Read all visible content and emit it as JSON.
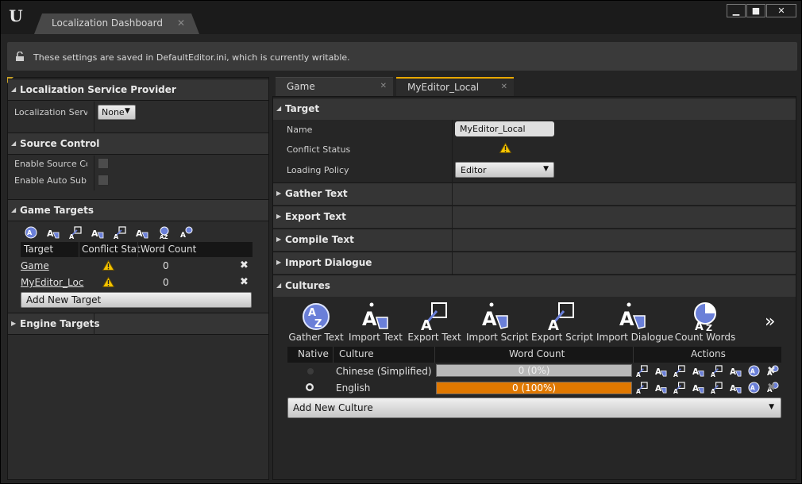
{
  "window": {
    "tab_title": "Localization Dashboard",
    "tab_close": "✕",
    "controls": {
      "minimize": "▁",
      "maximize": "■",
      "close": "✕"
    }
  },
  "infobar": {
    "text": "These settings are saved in DefaultEditor.ini, which is currently writable."
  },
  "left_panel": {
    "provider": {
      "header": "Localization Service Provider",
      "prop_label": "Localization Servi",
      "value": "None"
    },
    "source_control": {
      "header": "Source Control",
      "props": [
        "Enable Source Cor",
        "Enable Auto Subm"
      ]
    },
    "game_targets": {
      "header": "Game Targets",
      "toolbar_icons": [
        "gather-text-icon",
        "import-text-icon",
        "export-text-icon",
        "import-script-icon",
        "export-script-icon",
        "import-dialogue-icon",
        "count-words-icon",
        "compile-text-icon"
      ],
      "columns": [
        "Target",
        "Conflict Stat",
        "Word Count"
      ],
      "rows": [
        {
          "target": "Game",
          "word_count": "0"
        },
        {
          "target": "MyEditor_Loc",
          "word_count": "0"
        }
      ],
      "add_button": "Add New Target"
    },
    "engine_targets": {
      "header": "Engine Targets"
    }
  },
  "right_panel": {
    "tabs": [
      {
        "label": "Game",
        "active": false
      },
      {
        "label": "MyEditor_Local",
        "active": true
      }
    ],
    "target": {
      "header": "Target",
      "name_label": "Name",
      "name_value": "MyEditor_Local",
      "conflict_label": "Conflict Status",
      "policy_label": "Loading Policy",
      "policy_value": "Editor"
    },
    "sections": [
      "Gather Text",
      "Export Text",
      "Compile Text",
      "Import Dialogue"
    ],
    "cultures": {
      "header": "Cultures",
      "toolbar": [
        {
          "label": "Gather Text",
          "icon": "gather-text-icon"
        },
        {
          "label": "Import Text",
          "icon": "import-text-icon"
        },
        {
          "label": "Export Text",
          "icon": "export-text-icon"
        },
        {
          "label": "Import Script",
          "icon": "import-script-icon"
        },
        {
          "label": "Export Script",
          "icon": "export-script-icon"
        },
        {
          "label": "Import Dialogue",
          "icon": "import-dialogue-icon"
        },
        {
          "label": "Count Words",
          "icon": "count-words-icon"
        }
      ],
      "more": "»",
      "columns": [
        "Native",
        "Culture",
        "Word Count",
        "Actions"
      ],
      "rows": [
        {
          "culture": "Chinese (Simplified)",
          "native": false,
          "progress_label": "0 (0%)",
          "progress": 0.0
        },
        {
          "culture": "English",
          "native": true,
          "progress_label": "0 (100%)",
          "progress": 1.0
        }
      ],
      "add_button": "Add New Culture"
    }
  },
  "colors": {
    "accent": "#e07800",
    "warning": "#f5c400",
    "background": "#242424"
  }
}
